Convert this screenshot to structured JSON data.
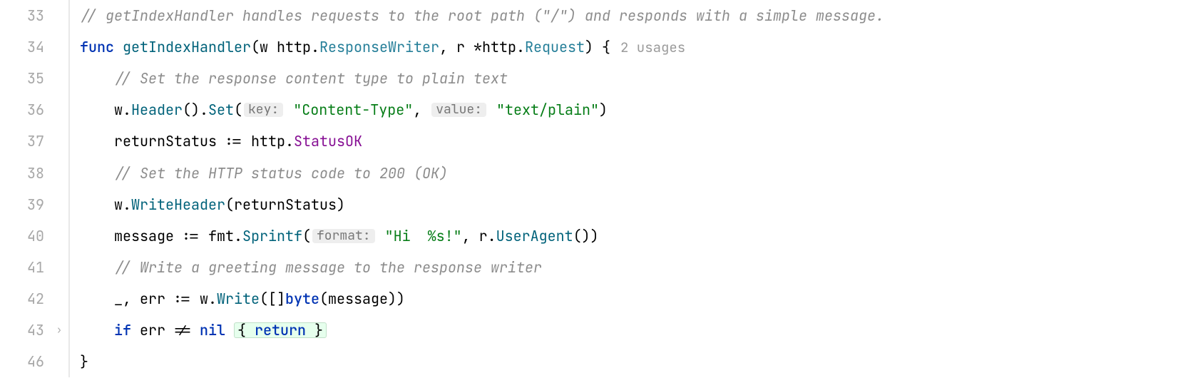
{
  "lines": {
    "33": {
      "num": "33",
      "comment": "// getIndexHandler handles requests to the root path (\"/\") and responds with a simple message."
    },
    "34": {
      "num": "34",
      "kw_func": "func",
      "fn": "getIndexHandler",
      "p1": "w",
      "t1a": "http",
      "t1b": "ResponseWriter",
      "p2": "r",
      "star": "*",
      "t2a": "http",
      "t2b": "Request",
      "brace": "{",
      "usages": "2 usages"
    },
    "35": {
      "num": "35",
      "comment": "// Set the response content type to plain text"
    },
    "36": {
      "num": "36",
      "w": "w",
      "Header": "Header",
      "Set": "Set",
      "hint_key": "key:",
      "str_key": "\"Content-Type\"",
      "hint_val": "value:",
      "str_val": "\"text/plain\""
    },
    "37": {
      "num": "37",
      "var": "returnStatus",
      "assign": ":=",
      "pkg": "http",
      "field": "StatusOK"
    },
    "38": {
      "num": "38",
      "comment": "// Set the HTTP status code to 200 (OK)"
    },
    "39": {
      "num": "39",
      "w": "w",
      "WriteHeader": "WriteHeader",
      "arg": "returnStatus"
    },
    "40": {
      "num": "40",
      "var": "message",
      "assign": ":=",
      "pkg": "fmt",
      "fn": "Sprintf",
      "hint_fmt": "format:",
      "str": "\"Hi  %s!\"",
      "r": "r",
      "UserAgent": "UserAgent"
    },
    "41": {
      "num": "41",
      "comment": "// Write a greeting message to the response writer"
    },
    "42": {
      "num": "42",
      "blank": "_",
      "err": "err",
      "assign": ":=",
      "w": "w",
      "Write": "Write",
      "byte": "byte",
      "msg": "message"
    },
    "43": {
      "num": "43",
      "if": "if",
      "err": "err",
      "ne": "!=",
      "nil": "nil",
      "lb": "{",
      "ret": "return",
      "rb": "}"
    },
    "46": {
      "num": "46",
      "brace": "}"
    }
  }
}
